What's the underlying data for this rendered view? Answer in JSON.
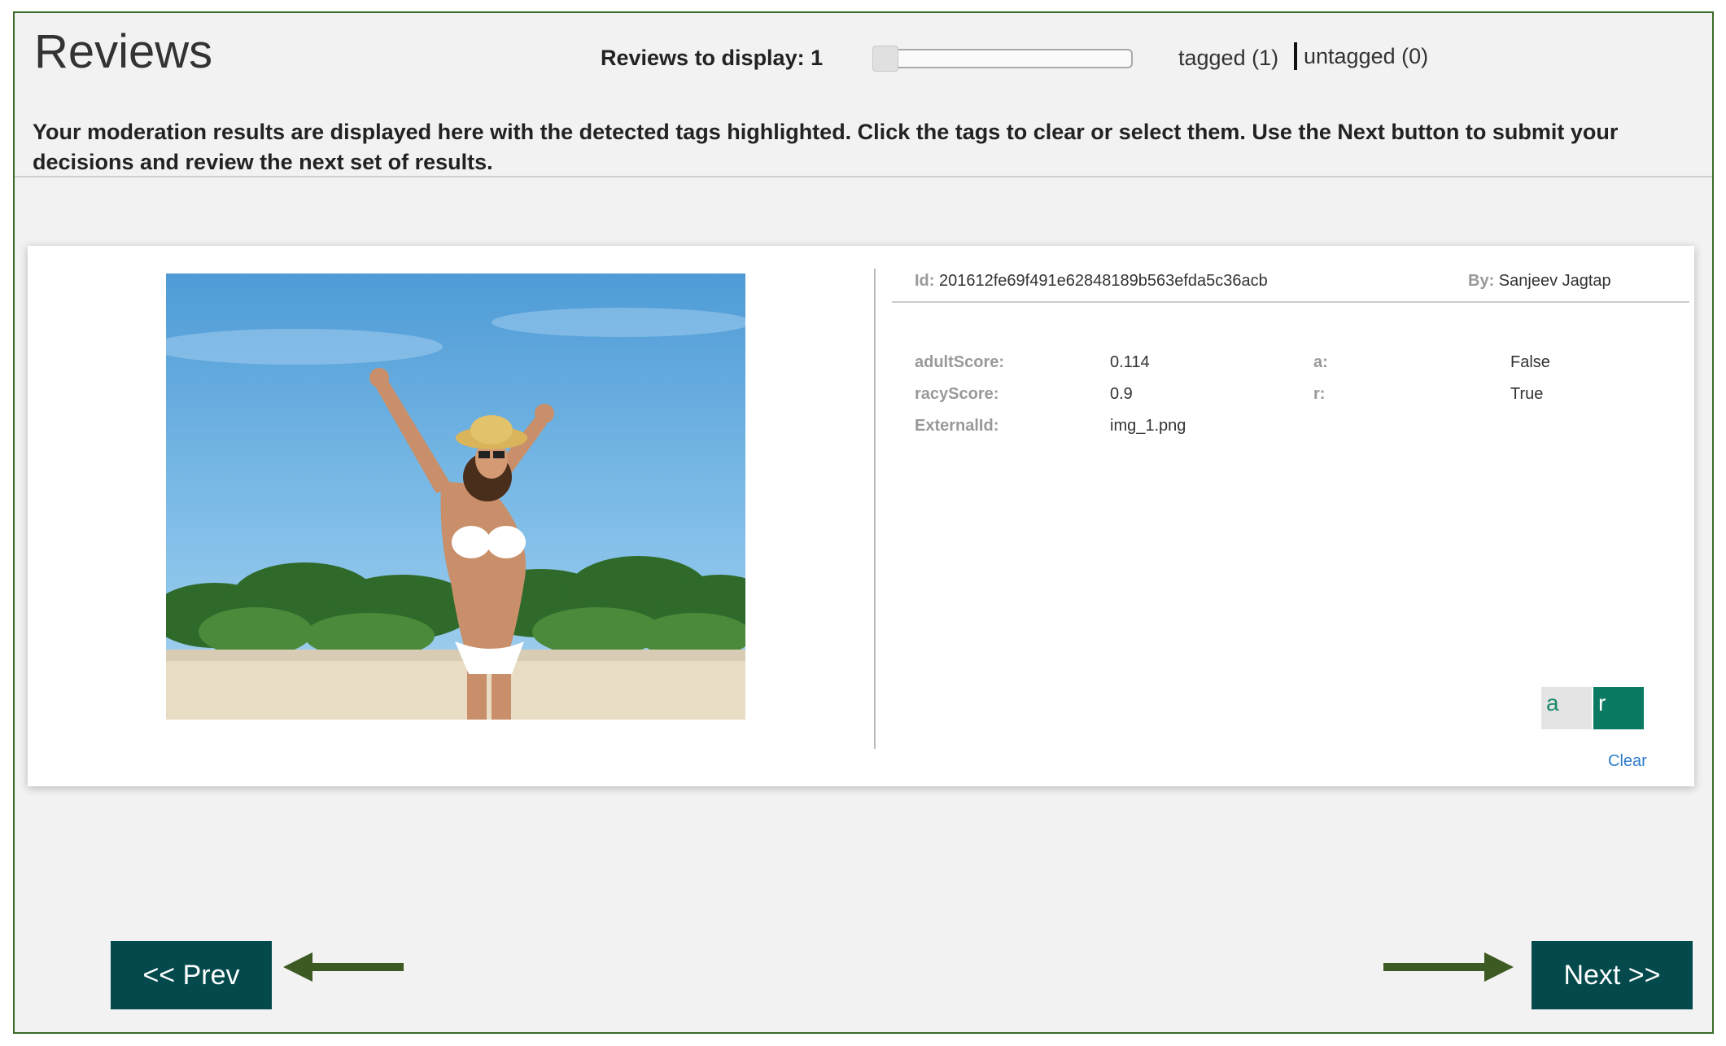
{
  "header": {
    "title": "Reviews",
    "display_label": "Reviews to display: 1",
    "slider_value": 1,
    "filters": {
      "tagged": "tagged (1)",
      "untagged": "untagged (0)"
    }
  },
  "instructions": "Your moderation results are displayed here with the detected tags highlighted. Click the tags to clear or select them. Use the Next button to submit your decisions and review the next set of results.",
  "review": {
    "id_label": "Id:",
    "id_value": "201612fe69f491e62848189b563efda5c36acb",
    "by_label": "By:",
    "by_value": "Sanjeev Jagtap",
    "metadata": [
      {
        "key": "adultScore:",
        "value": "0.114"
      },
      {
        "key": "racyScore:",
        "value": "0.9"
      },
      {
        "key": "ExternalId:",
        "value": "img_1.png"
      }
    ],
    "tag_values": [
      {
        "key": "a:",
        "value": "False"
      },
      {
        "key": "r:",
        "value": "True"
      }
    ],
    "tags": [
      {
        "label": "a",
        "selected": false
      },
      {
        "label": "r",
        "selected": true
      }
    ],
    "clear_label": "Clear"
  },
  "nav": {
    "prev_label": "<< Prev",
    "next_label": "Next >>"
  },
  "colors": {
    "frame_border": "#3a6b2a",
    "nav_button": "#044a4d",
    "tag_selected": "#0a7a63",
    "arrow": "#3d5a22"
  }
}
